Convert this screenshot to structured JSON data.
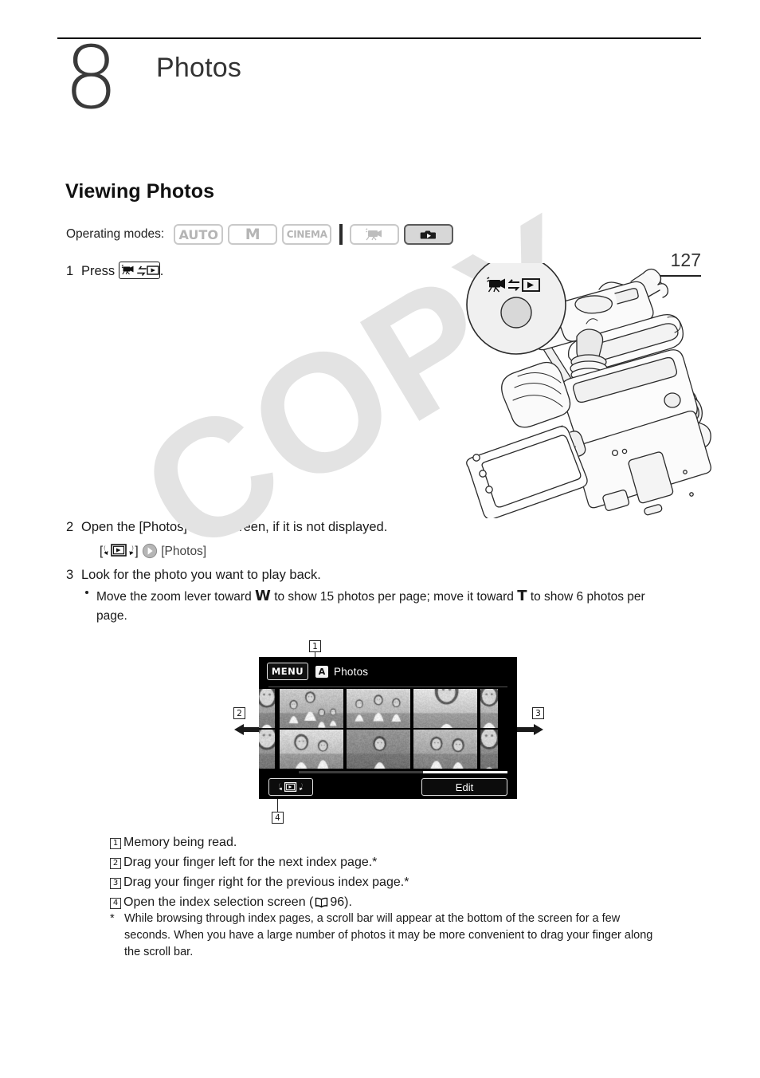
{
  "page": {
    "number": "127",
    "watermark": "COPY"
  },
  "chapter": {
    "number": "8",
    "title": "Photos"
  },
  "section": {
    "title": "Viewing Photos"
  },
  "operating_modes": {
    "label": "Operating modes:",
    "chips": [
      {
        "label": "AUTO",
        "state": "inactive",
        "icon": "auto-mode-icon"
      },
      {
        "label": "M",
        "state": "inactive",
        "icon": "manual-mode-icon"
      },
      {
        "label": "CINEMA",
        "state": "inactive",
        "icon": "cinema-mode-icon"
      },
      {
        "label": "",
        "state": "inactive",
        "icon": "video-playback-mode-icon"
      },
      {
        "label": "",
        "state": "active",
        "icon": "photo-playback-mode-icon"
      }
    ]
  },
  "steps": [
    {
      "num": "1",
      "text_before": "Press",
      "icon": "camera-playback-toggle-icon",
      "text_after": "."
    },
    {
      "num": "2",
      "text": "Open the [Photos] index screen, if it is not displayed."
    },
    {
      "num": "3",
      "text": "Look for the photo you want to play back."
    }
  ],
  "step2_path": {
    "bracket_open": "[",
    "icon": "index-selection-icon",
    "bracket_close": "]",
    "arrow": "next-arrow-icon",
    "target": "[Photos]"
  },
  "step3_bullet": {
    "part1": "Move the zoom lever toward",
    "wide": "W",
    "part2": "to show 15 photos per page; move it toward",
    "tele": "T",
    "part3": "to show 6 photos per page."
  },
  "figure": {
    "screen": {
      "menu_label": "MENU",
      "memory_badge": "A",
      "title": "Photos",
      "index_selection_icon": "index-selection-icon",
      "edit_label": "Edit"
    },
    "callouts": [
      "1",
      "2",
      "3",
      "4"
    ]
  },
  "legend": [
    {
      "num": "1",
      "text": "Memory being read."
    },
    {
      "num": "2",
      "text": "Drag your finger left for the next index page.*"
    },
    {
      "num": "3",
      "text": "Drag your finger right for the previous index page.*"
    },
    {
      "num": "4",
      "text_before": "Open the index selection screen (",
      "book_icon": "book-reference-icon",
      "page_ref": "96",
      "text_after": ")."
    }
  ],
  "footnote": {
    "marker": "*",
    "text": "While browsing through index pages, a scroll bar will appear at the bottom of the screen for a few seconds. When you have a large number of photos it may be more convenient to drag your finger along the scroll bar."
  }
}
